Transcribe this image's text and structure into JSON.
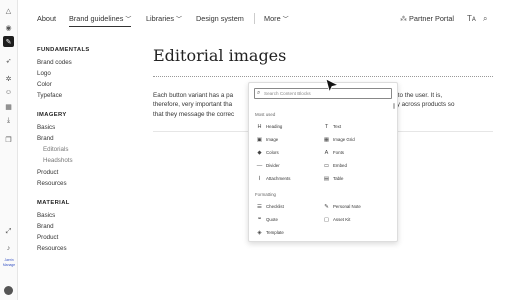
{
  "rail": {
    "icons": [
      "logo-icon",
      "eye-icon",
      "pen-icon",
      "rocket-icon",
      "settings-icon",
      "users-icon",
      "calendar-icon",
      "download-icon",
      "copy-icon",
      "expand-icon",
      "bell-icon"
    ],
    "user_text": "Jaerin\nManage"
  },
  "nav": {
    "about": "About",
    "brand_guidelines": "Brand guidelines",
    "libraries": "Libraries",
    "design_system": "Design system",
    "more": "More",
    "partner_portal": "Partner Portal",
    "translate_icon": "Tᴀ",
    "search_icon": "search-icon"
  },
  "sidebar": {
    "fundamentals_heading": "FUNDAMENTALS",
    "fundamentals": [
      "Brand codes",
      "Logo",
      "Color",
      "Typeface"
    ],
    "imagery_heading": "IMAGERY",
    "imagery": [
      "Basics",
      "Brand"
    ],
    "imagery_sub": [
      "Editorials",
      "Headshots"
    ],
    "imagery_more": [
      "Product",
      "Resources"
    ],
    "material_heading": "MATERIAL",
    "material": [
      "Basics",
      "Brand",
      "Product",
      "Resources"
    ]
  },
  "main": {
    "title": "Editorial images",
    "para_lines": [
      "Each button variant has a pa",
      "therefore, very important tha",
      "that they message the correc"
    ],
    "para_right": [
      "nction to the user. It is,",
      "sistently across products so",
      ""
    ]
  },
  "popup": {
    "search_placeholder": "Search Content Blocks",
    "most_used_label": "Most used",
    "most_used": [
      {
        "icon": "heading-icon",
        "label": "Heading",
        "glyph": "H"
      },
      {
        "icon": "text-icon",
        "label": "Text",
        "glyph": "T"
      },
      {
        "icon": "image-icon",
        "label": "Image",
        "glyph": "▣"
      },
      {
        "icon": "image-grid-icon",
        "label": "Image Grid",
        "glyph": "▦"
      },
      {
        "icon": "colors-icon",
        "label": "Colors",
        "glyph": "◆"
      },
      {
        "icon": "fonts-icon",
        "label": "Fonts",
        "glyph": "A"
      },
      {
        "icon": "divider-icon",
        "label": "Divider",
        "glyph": "—"
      },
      {
        "icon": "embed-icon",
        "label": "Embed",
        "glyph": "▭"
      },
      {
        "icon": "attachments-icon",
        "label": "Attachments",
        "glyph": "⌇"
      },
      {
        "icon": "table-icon",
        "label": "Table",
        "glyph": "▤"
      }
    ],
    "formatting_label": "Formatting",
    "formatting": [
      {
        "icon": "checklist-icon",
        "label": "Checklist",
        "glyph": "☰"
      },
      {
        "icon": "personal-note-icon",
        "label": "Personal Note",
        "glyph": "✎"
      },
      {
        "icon": "quote-icon",
        "label": "Quote",
        "glyph": "❝"
      },
      {
        "icon": "asset-kit-icon",
        "label": "Asset Kit",
        "glyph": "▢"
      },
      {
        "icon": "template-icon",
        "label": "Template",
        "glyph": "◈"
      }
    ]
  }
}
